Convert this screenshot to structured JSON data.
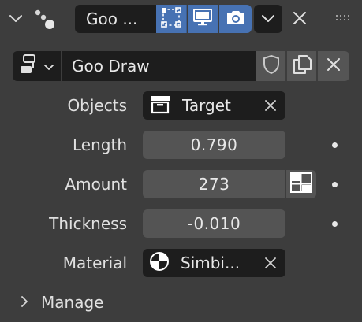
{
  "header": {
    "object_name": "Goo ...",
    "icons": [
      "chevron-down-icon",
      "particles-icon",
      "selectable-icon",
      "viewport-icon",
      "render-camera-icon",
      "chevron-down-icon",
      "close-icon",
      "drag-handle-icon"
    ]
  },
  "modifier": {
    "name": "Goo Draw",
    "type_icon": "modifier-type-icon",
    "buttons": [
      "shield-icon",
      "copy-icon",
      "close-icon"
    ]
  },
  "properties": {
    "objects": {
      "label": "Objects",
      "value": "Target"
    },
    "length": {
      "label": "Length",
      "value": "0.790"
    },
    "amount": {
      "label": "Amount",
      "value": "273"
    },
    "thickness": {
      "label": "Thickness",
      "value": "-0.010"
    },
    "material": {
      "label": "Material",
      "value": "Simbi..."
    }
  },
  "manage": {
    "label": "Manage"
  },
  "colors": {
    "background": "#3d3d3d",
    "field_dark": "#1d1d1d",
    "field_mid": "#545454",
    "accent": "#4772b3",
    "text": "#e6e6e6"
  }
}
